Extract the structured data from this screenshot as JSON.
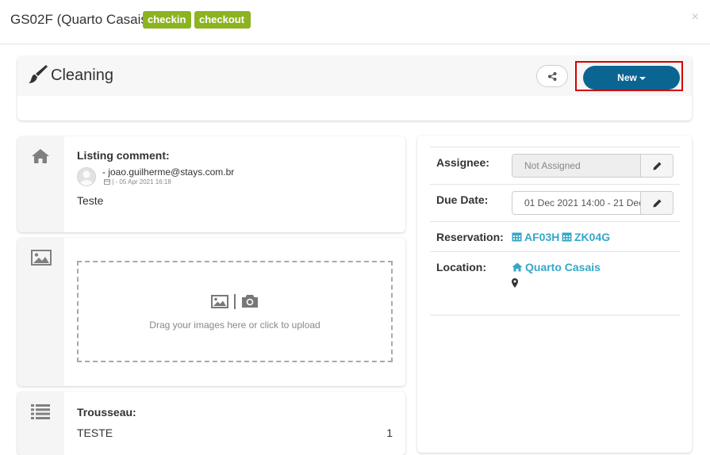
{
  "modal": {
    "title": "GS02F (Quarto Casais)",
    "badges": [
      "checkin",
      "checkout"
    ],
    "close_label": "×"
  },
  "task": {
    "title": "Cleaning",
    "new_button_label": "New"
  },
  "comment": {
    "label": "Listing comment:",
    "author": "- joao.guilherme@stays.com.br",
    "meta": "| - 05 Apr 2021 16:18",
    "text": "Teste"
  },
  "upload": {
    "hint": "Drag your images here or click to upload"
  },
  "trousseau": {
    "label": "Trousseau:",
    "items": [
      {
        "name": "TESTE",
        "qty": "1"
      }
    ]
  },
  "details": {
    "assignee_label": "Assignee:",
    "assignee_value": "Not Assigned",
    "due_label": "Due Date:",
    "due_value": "01 Dec 2021 14:00 - 21 Dec",
    "reservation_label": "Reservation:",
    "reservations": [
      "AF03H",
      "ZK04G"
    ],
    "location_label": "Location:",
    "location_value": "Quarto Casais"
  },
  "colors": {
    "badge": "#8cb320",
    "primary_button": "#0b6592",
    "link": "#36a7c7",
    "highlight_frame": "#d40000"
  },
  "icons": {
    "task": "paint-brush-icon",
    "share": "share-icon",
    "comment_section": "home-icon",
    "images_section": "image-icon",
    "trousseau_section": "list-icon",
    "edit": "pencil-icon",
    "calendar": "calendar-icon",
    "location": "home-icon",
    "map": "map-marker-icon"
  }
}
